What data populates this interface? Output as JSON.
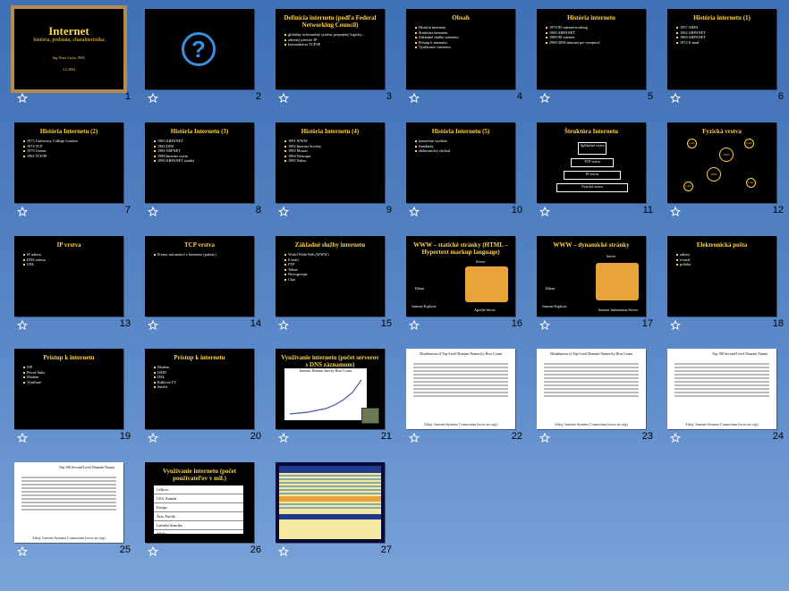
{
  "slides": [
    {
      "n": "1",
      "title": "Internet",
      "subtitle": "história, podstata, charakteristika",
      "lines": [
        "Ing. Peter Lacko, PhD.",
        "3.2.2004"
      ],
      "selected": true
    },
    {
      "n": "2",
      "title": "",
      "lines": []
    },
    {
      "n": "3",
      "title": "Definícia internetu (podľa Federal Networking Council)",
      "lines": [
        "globálny informačný systém, prepojený logicky...",
        "adresný priestor IP",
        "komunikácia TCP/IP"
      ]
    },
    {
      "n": "4",
      "title": "Obsah",
      "lines": [
        "História internetu",
        "Štruktúra internetu",
        "Základné služby internetu",
        "Prístup k internetu",
        "Využívanie internetu"
      ]
    },
    {
      "n": "5",
      "title": "História internetu",
      "lines": [
        "1970-85 internetworking",
        "1969 ARPANET",
        "1980-90 internet",
        "1990-2000 internet pre verejnosť"
      ]
    },
    {
      "n": "6",
      "title": "História internetu (1)",
      "lines": [
        "1957 ARPA",
        "1962 ARPANET",
        "1969 ARPANET",
        "1972 E-mail"
      ]
    },
    {
      "n": "7",
      "title": "História Internetu (2)",
      "lines": [
        "1973 University College London",
        "1974 TCP",
        "1979 Usenet",
        "1982 TCP/IP"
      ]
    },
    {
      "n": "8",
      "title": "História Internetu (3)",
      "lines": [
        "1983 ARPANET",
        "1984 DNS",
        "1986 NSFNET",
        "1988 Internet worm",
        "1990 ARPANET zaniká"
      ]
    },
    {
      "n": "9",
      "title": "História Internetu (4)",
      "lines": [
        "1991 WWW",
        "1992 Internet Society",
        "1993 Mosaic",
        "1994 Netscape",
        "1995 Yahoo"
      ]
    },
    {
      "n": "10",
      "title": "História Internetu (5)",
      "lines": [
        "komerčné využitie",
        "štandardy",
        "elektronický obchod"
      ]
    },
    {
      "n": "11",
      "title": "Štruktúra Internetu",
      "lines": [
        "Aplikačná vrstva",
        "TCP vrstva",
        "IP vrstva",
        "Fyzická vrstva"
      ]
    },
    {
      "n": "12",
      "title": "Fyzická vrstva",
      "lines": [
        "LAN",
        "WAN",
        "LAN",
        "WAN",
        "LAN",
        "LAN"
      ]
    },
    {
      "n": "13",
      "title": "IP vrstva",
      "lines": [
        "IP adresa",
        "DNS adresa",
        "URL"
      ]
    },
    {
      "n": "14",
      "title": "TCP vrstva",
      "lines": [
        "Prenos informácií v Internete (pakety)"
      ]
    },
    {
      "n": "15",
      "title": "Základné služby internetu",
      "lines": [
        "World Wide Web (WWW)",
        "E-mail",
        "FTP",
        "Telnet",
        "Newsgroups",
        "Chat"
      ]
    },
    {
      "n": "16",
      "title": "WWW – statické stránky (HTML – Hypertext markup language)",
      "lines": [
        "Klient",
        "Server",
        "Internet Explorer",
        "Apache Server"
      ]
    },
    {
      "n": "17",
      "title": "WWW – dynamické stránky",
      "lines": [
        "Klient",
        "Server",
        "Internet Explorer",
        "Internet Information Server"
      ]
    },
    {
      "n": "18",
      "title": "Elektronická pošta",
      "lines": [
        "adresy",
        "e-mail",
        "príloha"
      ]
    },
    {
      "n": "19",
      "title": "Prístup k internetu",
      "lines": [
        "ISP",
        "Pevné linky",
        "Modem",
        "Vytáčané"
      ]
    },
    {
      "n": "20",
      "title": "Prístup k internetu",
      "lines": [
        "Modem",
        "ISDN",
        "DSL",
        "Káblová TV",
        "Satelit"
      ]
    },
    {
      "n": "21",
      "title": "Využívanie internetu (počet serverov s DNS záznamom)",
      "lines": [
        "Internet Domain Survey Host Count"
      ]
    },
    {
      "n": "22",
      "title": "Distribution of Top-Level Domain Names by Host Count",
      "lines": [
        "Zdroj: Internet Systems Consortium (www.isc.org)"
      ]
    },
    {
      "n": "23",
      "title": "Distribution of Top-Level Domain Names by Host Count",
      "lines": [
        "Zdroj: Internet Systems Consortium (www.isc.org)"
      ]
    },
    {
      "n": "24",
      "title": "Top 100 Second-Level Domain Names",
      "lines": [
        "Zdroj: Internet Systems Consortium (www.isc.org)"
      ]
    },
    {
      "n": "25",
      "title": "Top 100 Second-Level Domain Names",
      "lines": [
        "Zdroj: Internet Systems Consortium (www.isc.org)"
      ]
    },
    {
      "n": "26",
      "title": "Využívanie internetu (počet používateľov v mil.)",
      "lines": [
        "Celkovo",
        "USA, Kanada",
        "Európa",
        "Ázia, Pacifik",
        "Latinská Amerika",
        "Afrika"
      ]
    },
    {
      "n": "27",
      "title": "",
      "lines": []
    }
  ]
}
